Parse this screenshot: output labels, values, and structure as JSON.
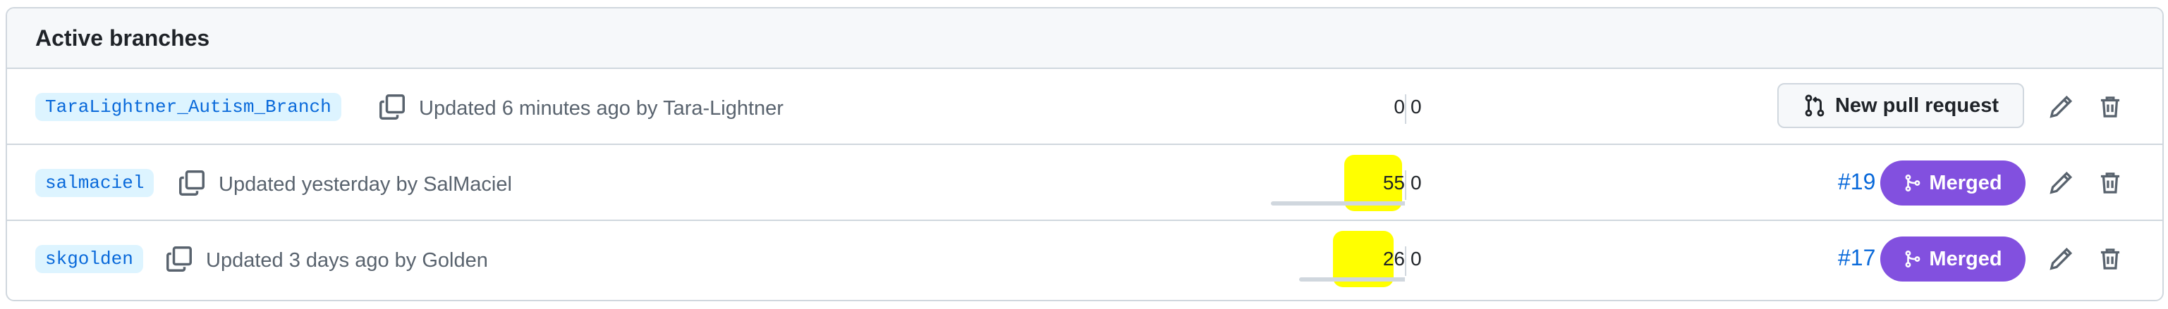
{
  "header": {
    "title": "Active branches"
  },
  "branches": [
    {
      "name": "TaraLightner_Autism_Branch",
      "updated": "Updated 6 minutes ago by Tara-Lightner",
      "behind": "0",
      "ahead": "0",
      "action": "New pull request"
    },
    {
      "name": "salmaciel",
      "updated": "Updated yesterday by SalMaciel",
      "behind": "55",
      "ahead": "0",
      "pr_number": "#19",
      "pr_status": "Merged"
    },
    {
      "name": "skgolden",
      "updated": "Updated 3 days ago by Golden",
      "behind": "26",
      "ahead": "0",
      "pr_number": "#17",
      "pr_status": "Merged"
    }
  ],
  "icons": {
    "copy": "copy-icon",
    "pull_request": "git-pull-request-icon",
    "merge": "git-merge-icon",
    "edit": "pencil-icon",
    "delete": "trash-icon"
  },
  "colors": {
    "link": "#0969da",
    "merged": "#8250df",
    "highlight": "#ffff00",
    "branch_bg": "#ddf4ff"
  }
}
